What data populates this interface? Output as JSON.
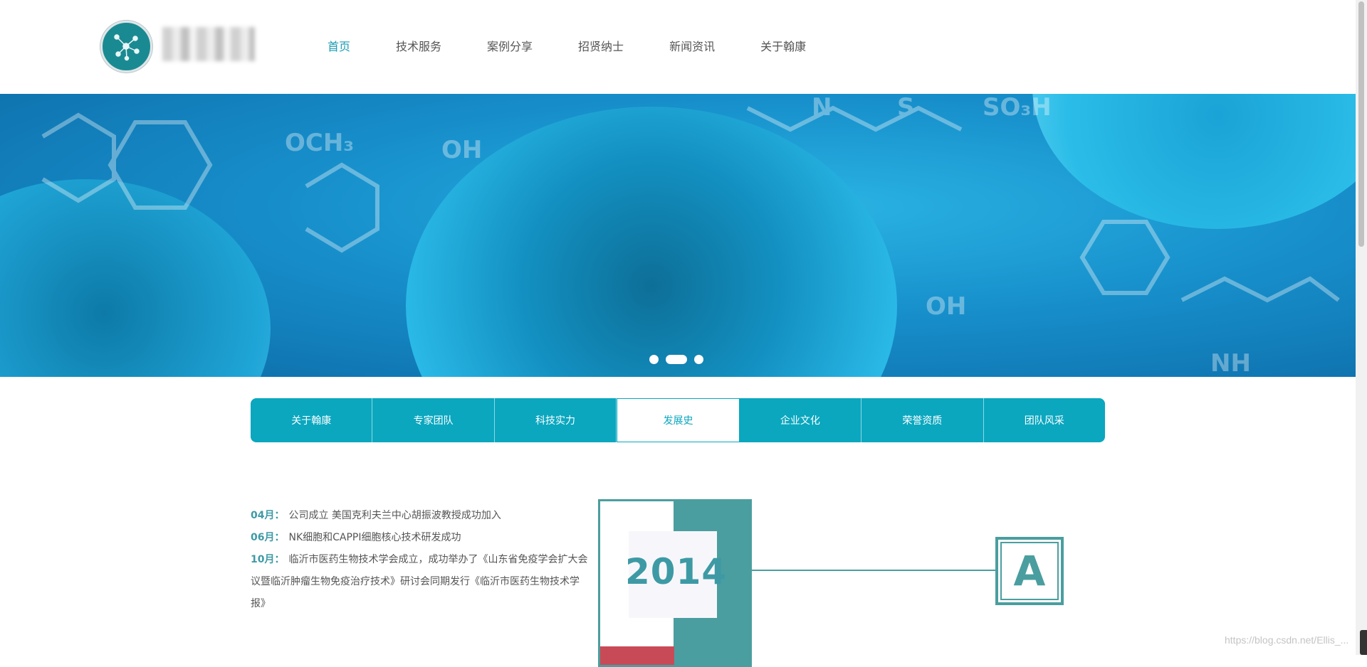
{
  "header": {
    "nav": [
      "首页",
      "技术服务",
      "案例分享",
      "招贤纳士",
      "新闻资讯",
      "关于翰康"
    ]
  },
  "banner": {
    "molecule_labels": [
      "OCH₃",
      "OH",
      "N",
      "S",
      "SO₃H",
      "NH"
    ]
  },
  "subnav": {
    "tabs": [
      "关于翰康",
      "专家团队",
      "科技实力",
      "发展史",
      "企业文化",
      "荣誉资质",
      "团队风采"
    ],
    "active_index": 3
  },
  "history": {
    "year": "2014",
    "marker": "A",
    "events": [
      {
        "month": "04月：",
        "text": "公司成立 美国克利夫兰中心胡振波教授成功加入"
      },
      {
        "month": "06月：",
        "text": "NK细胞和CAPPI细胞核心技术研发成功"
      },
      {
        "month": "10月：",
        "text": "临沂市医药生物技术学会成立，成功举办了《山东省免疫学会扩大会议暨临沂肿瘤生物免疫治疗技术》研讨会同期发行《临沂市医药生物技术学报》"
      }
    ]
  },
  "watermark": "https://blog.csdn.net/Ellis_...",
  "colors": {
    "accent": "#0aa7bf",
    "teal": "#4b9e9f",
    "red": "#c94a57"
  }
}
